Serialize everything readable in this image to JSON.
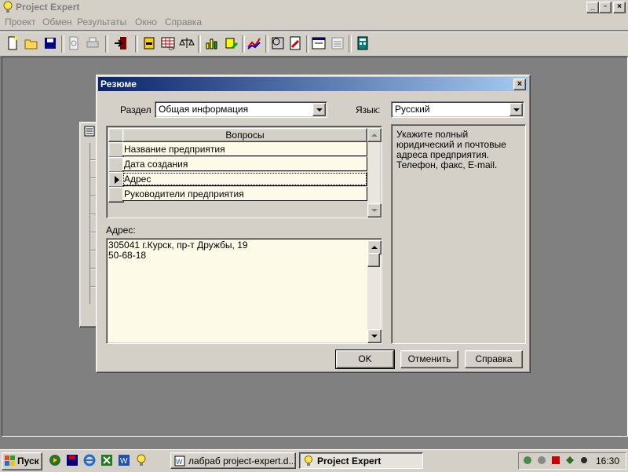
{
  "window": {
    "title": "Project Expert"
  },
  "menu": [
    "Проект",
    "Обмен",
    "Результаты",
    "Окно",
    "Справка"
  ],
  "dialog": {
    "title": "Резюме",
    "section_label": "Раздел",
    "section_value": "Общая информация",
    "language_label": "Язык:",
    "language_value": "Русский",
    "grid_header": "Вопросы",
    "questions": [
      "Название предприятия",
      "Дата создания",
      "Адрес",
      "Руководители предприятия"
    ],
    "selected_index": 2,
    "answer_label": "Адрес:",
    "answer_text": "305041 г.Курск, пр-т Дружбы, 19\n50-68-18",
    "hint_text": "Укажите полный юридический и почтовые адреса предприятия. Телефон, факс, E-mail.",
    "buttons": {
      "ok": "OK",
      "cancel": "Отменить",
      "help": "Справка"
    }
  },
  "taskbar": {
    "start_label": "Пуск",
    "tasks": [
      {
        "label": "лабраб project-expert.d..."
      },
      {
        "label": "Project Expert"
      }
    ],
    "clock": "16:30"
  }
}
